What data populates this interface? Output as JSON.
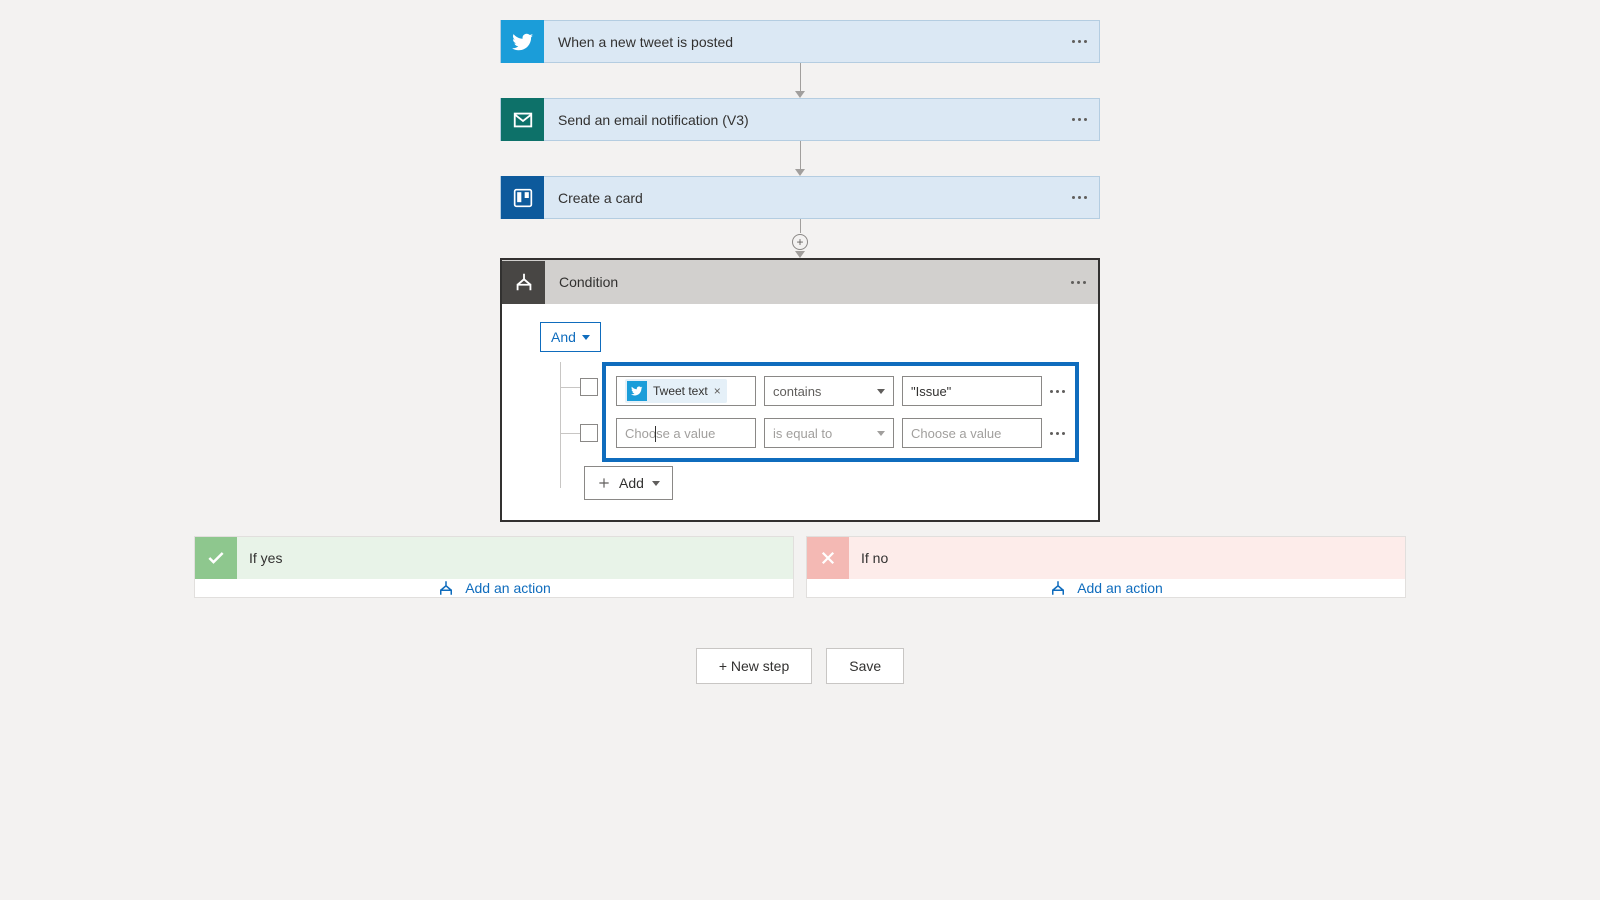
{
  "steps": {
    "s1": {
      "title": "When a new tweet is posted"
    },
    "s2": {
      "title": "Send an email notification (V3)"
    },
    "s3": {
      "title": "Create a card"
    }
  },
  "condition": {
    "title": "Condition",
    "logic_label": "And",
    "add_label": "Add",
    "rows": [
      {
        "token_label": "Tweet text",
        "operator": "contains",
        "value": "\"Issue\""
      },
      {
        "left_placeholder": "Choose a value",
        "operator": "is equal to",
        "right_placeholder": "Choose a value"
      }
    ]
  },
  "branches": {
    "yes": {
      "title": "If yes",
      "add_action": "Add an action"
    },
    "no": {
      "title": "If no",
      "add_action": "Add an action"
    }
  },
  "buttons": {
    "new_step": "+ New step",
    "save": "Save"
  }
}
